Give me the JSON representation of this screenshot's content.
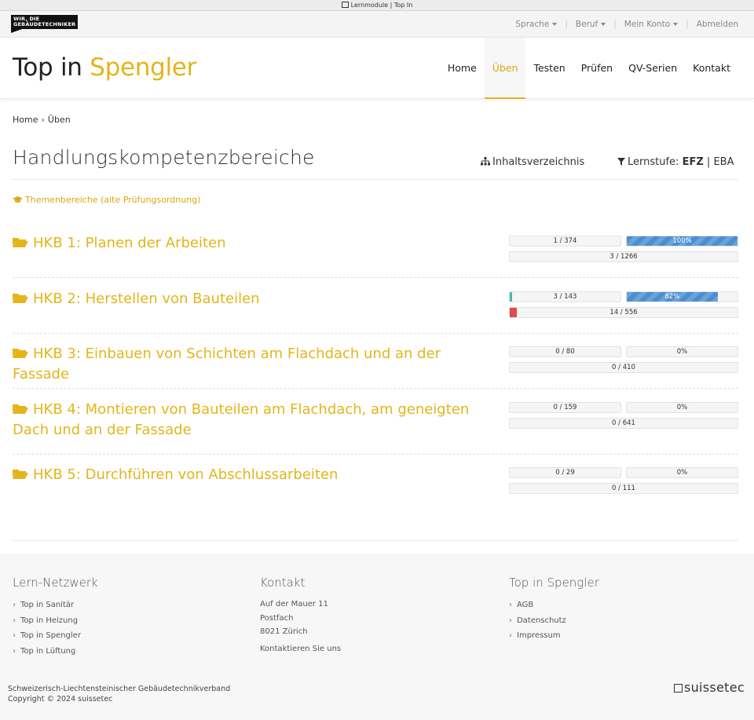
{
  "browser": {
    "tab_title": "Lernmodule | Top In"
  },
  "topbar": {
    "logo_line1": "WIR, DIE",
    "logo_line2": "GEBÄUDETECHNIKER",
    "links": [
      "Sprache",
      "Beruf",
      "Mein Konto",
      "Abmelden"
    ]
  },
  "header": {
    "title_main": "Top in",
    "title_accent": "Spengler",
    "nav": [
      "Home",
      "Üben",
      "Testen",
      "Prüfen",
      "QV-Serien",
      "Kontakt"
    ],
    "active_nav": "Üben"
  },
  "breadcrumb": {
    "home": "Home",
    "current": "Üben"
  },
  "page": {
    "title": "Handlungskompetenzbereiche",
    "toc_link": "Inhaltsverzeichnis",
    "level_label": "Lernstufe:",
    "level_active": "EFZ",
    "level_sep": "|",
    "level_other": "EBA",
    "themes_link": "Themenbereiche (alte Prüfungsordnung)"
  },
  "hkb": [
    {
      "title": "HKB 1: Planen der Arbeiten",
      "count": "1 / 374",
      "percent_label": "100%",
      "percent": 100,
      "count_fill": 0,
      "total": "3 / 1266",
      "total_fill": 0
    },
    {
      "title": "HKB 2: Herstellen von Bauteilen",
      "count": "3 / 143",
      "percent_label": "82%",
      "percent": 82,
      "count_fill": 2,
      "total": "14 / 556",
      "total_fill": 3
    },
    {
      "title": "HKB 3: Einbauen von Schichten am Flachdach und an der Fassade",
      "count": "0 / 80",
      "percent_label": "0%",
      "percent": 0,
      "count_fill": 0,
      "total": "0 / 410",
      "total_fill": 0
    },
    {
      "title": "HKB 4: Montieren von Bauteilen am Flachdach, am geneigten Dach und an der Fassade",
      "count": "0 / 159",
      "percent_label": "0%",
      "percent": 0,
      "count_fill": 0,
      "total": "0 / 641",
      "total_fill": 0
    },
    {
      "title": "HKB 5: Durchführen von Abschlussarbeiten",
      "count": "0 / 29",
      "percent_label": "0%",
      "percent": 0,
      "count_fill": 0,
      "total": "0 / 111",
      "total_fill": 0
    }
  ],
  "footer": {
    "col1": {
      "heading": "Lern-Netzwerk",
      "items": [
        "Top in Sanitär",
        "Top in Heizung",
        "Top in Spengler",
        "Top in Lüftung"
      ]
    },
    "col2": {
      "heading": "Kontakt",
      "address": [
        "Auf der Mauer 11",
        "Postfach",
        "8021 Zürich"
      ],
      "contact_link": "Kontaktieren Sie uns"
    },
    "col3": {
      "heading": "Top in Spengler",
      "items": [
        "AGB",
        "Datenschutz",
        "Impressum"
      ]
    },
    "org": "Schweizerisch-Liechtensteinischer Gebäudetechnikverband",
    "copyright": "Copyright © 2024 suissetec",
    "brand": "suissetec"
  },
  "colors": {
    "accent": "#e3b51b",
    "progress": "#4a8fd0",
    "teal": "#4bb8b0",
    "red": "#e04a4a"
  }
}
